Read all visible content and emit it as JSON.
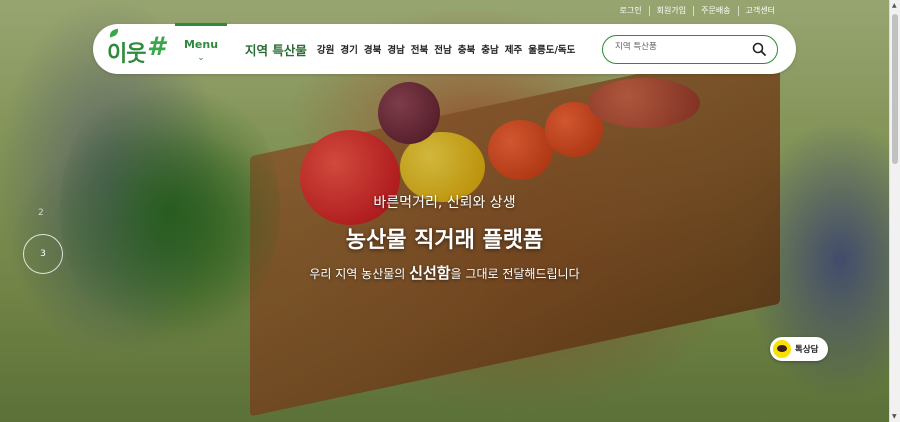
{
  "util_links": [
    "로그인",
    "회원가입",
    "주문배송",
    "고객센터"
  ],
  "logo": {
    "text": "이웃",
    "mark": "#"
  },
  "nav": {
    "menu_label": "Menu",
    "title": "지역 특산물",
    "regions": [
      "강원",
      "경기",
      "경북",
      "경남",
      "전북",
      "전남",
      "충북",
      "충남",
      "제주",
      "울릉도/독도"
    ]
  },
  "search": {
    "placeholder": "지역 특산품",
    "icon": "search-icon"
  },
  "hero": {
    "subtitle": "바른먹거리, 신뢰와 상생",
    "headline": "농산물 직거래 플랫폼",
    "desc_before": "우리 지역 농산물의 ",
    "desc_bold": "신선함",
    "desc_after": "을 그대로 전달해드립니다"
  },
  "slider": {
    "prev": "2",
    "current": "3"
  },
  "talk": {
    "label": "톡상담",
    "icon": "kakao-talk-icon"
  },
  "colors": {
    "brand_green": "#2f8a3b",
    "kakao_yellow": "#f9e000"
  }
}
